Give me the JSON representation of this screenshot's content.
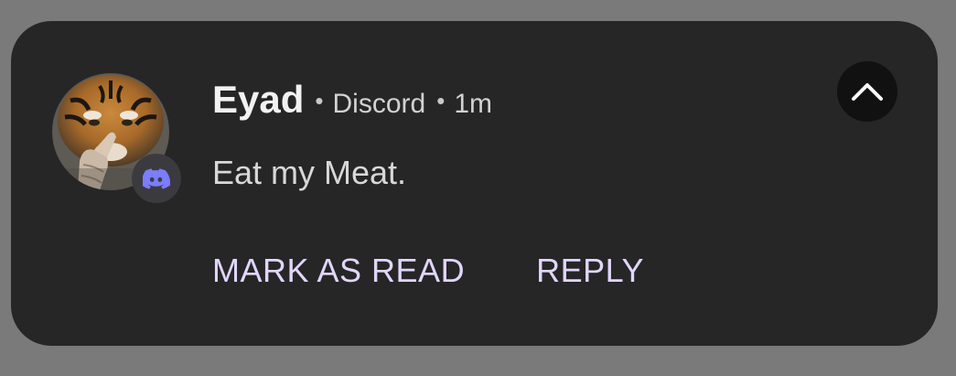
{
  "notification": {
    "sender": "Eyad",
    "separator": "•",
    "app_name": "Discord",
    "time": "1m",
    "message": "Eat my Meat.",
    "avatar_icon": "tiger-avatar-icon",
    "app_icon": "discord-icon",
    "collapse_icon": "chevron-up-icon"
  },
  "actions": {
    "mark_as_read": "MARK AS READ",
    "reply": "REPLY"
  },
  "colors": {
    "card_background": "#262626",
    "screen_background": "#7a7a7a",
    "action_text": "#e1d6ff",
    "discord_blurple": "#7c7dff"
  }
}
